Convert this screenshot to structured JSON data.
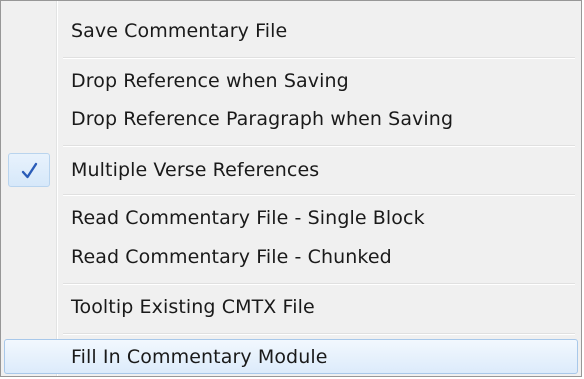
{
  "menu": {
    "items": [
      {
        "label": "Save Commentary File",
        "checked": false,
        "hovered": false
      },
      {
        "label": "Drop Reference when Saving",
        "checked": false,
        "hovered": false
      },
      {
        "label": "Drop Reference Paragraph when Saving",
        "checked": false,
        "hovered": false
      },
      {
        "label": "Multiple Verse References",
        "checked": true,
        "hovered": false
      },
      {
        "label": "Read Commentary File - Single Block",
        "checked": false,
        "hovered": false
      },
      {
        "label": "Read Commentary File - Chunked",
        "checked": false,
        "hovered": false
      },
      {
        "label": "Tooltip Existing CMTX File",
        "checked": false,
        "hovered": false
      },
      {
        "label": "Fill In Commentary Module",
        "checked": false,
        "hovered": true
      }
    ],
    "check_icon": "checkmark-icon",
    "check_color": "#2a5cb8",
    "hover_color": "#dcebfb"
  }
}
